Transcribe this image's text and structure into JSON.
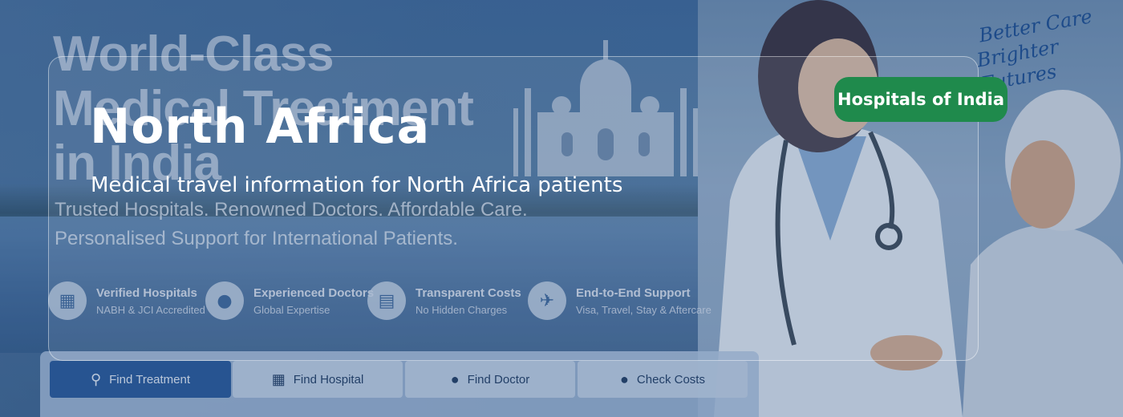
{
  "background": {
    "headline_lines": [
      "World-Class",
      "Medical Treatment",
      "in India"
    ],
    "subtitle_lines": [
      "Trusted Hospitals. Renowned Doctors. Affordable Care.",
      "Personalised Support for International Patients."
    ],
    "script_lines": [
      "Better Care",
      "Brighter Futures"
    ],
    "features": [
      {
        "icon": "hospital-icon",
        "title": "Verified Hospitals",
        "subtitle": "NABH & JCI Accredited"
      },
      {
        "icon": "doctor-icon",
        "title": "Experienced Doctors",
        "subtitle": "Global Expertise"
      },
      {
        "icon": "document-icon",
        "title": "Transparent Costs",
        "subtitle": "No Hidden Charges"
      },
      {
        "icon": "airplane-icon",
        "title": "End-to-End Support",
        "subtitle": "Visa, Travel, Stay & Aftercare"
      }
    ],
    "tabs": [
      {
        "icon": "search-icon",
        "label": "Find Treatment",
        "active": true
      },
      {
        "icon": "building-icon",
        "label": "Find Hospital",
        "active": false
      },
      {
        "icon": "user-icon",
        "label": "Find Doctor",
        "active": false
      },
      {
        "icon": "coins-icon",
        "label": "Check Costs",
        "active": false
      }
    ]
  },
  "hero": {
    "title": "North Africa",
    "description": "Medical travel information for North Africa patients"
  },
  "badge": {
    "label": "Hospitals of India",
    "color": "#1f8a4c"
  },
  "colors": {
    "accent_blue": "#2a5a9c",
    "badge_green": "#1f8a4c"
  }
}
